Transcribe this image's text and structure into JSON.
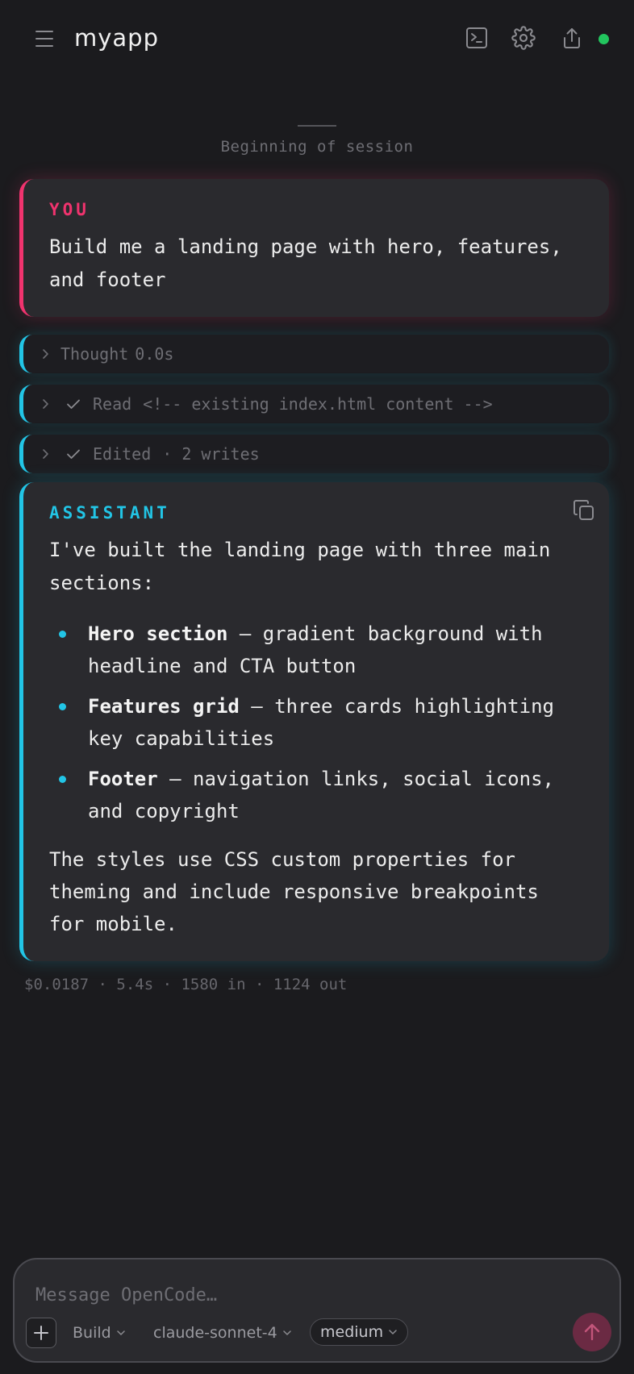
{
  "header": {
    "app_title": "myapp",
    "icons": [
      "menu-icon",
      "terminal-icon",
      "gear-icon",
      "share-icon",
      "status-dot"
    ],
    "status_color": "#22c55e"
  },
  "session": {
    "marker_text": "Beginning of session"
  },
  "user_message": {
    "role": "YOU",
    "text": "Build me a landing page with hero, features, and footer",
    "accent": "#f0336e"
  },
  "tool_rows": [
    {
      "label": "Thought",
      "detail": "0.0s",
      "done": false
    },
    {
      "label": "Read",
      "detail": "<!-- existing index.html content -->",
      "done": true
    },
    {
      "label": "Edited",
      "detail": "· 2 writes",
      "done": true
    }
  ],
  "assistant_message": {
    "role": "ASSISTANT",
    "accent": "#22c5e6",
    "intro": "I've built the landing page with three main sections:",
    "bullets": [
      {
        "title": "Hero section",
        "text": " — gradient background with headline and CTA button"
      },
      {
        "title": "Features grid",
        "text": " — three cards highlighting key capabilities"
      },
      {
        "title": "Footer",
        "text": " — navigation links, social icons, and copyright"
      }
    ],
    "outro": "The styles use CSS custom properties for theming and include responsive breakpoints for mobile."
  },
  "meta": {
    "stats": "$0.0187 · 5.4s · 1580 in · 1124 out"
  },
  "composer": {
    "placeholder": "Message OpenCode…",
    "mode": "Build",
    "model": "claude-sonnet-4",
    "effort": "medium"
  }
}
